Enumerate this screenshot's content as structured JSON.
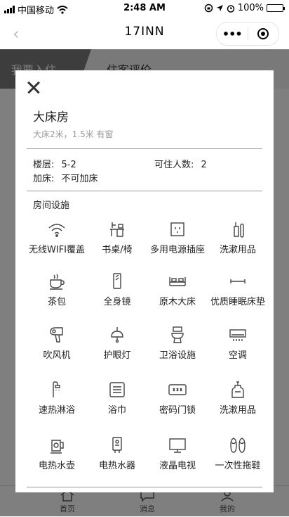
{
  "status": {
    "carrier": "中国移动",
    "time": "2:48 AM",
    "battery": "100%"
  },
  "nav": {
    "title": "17INN"
  },
  "page": {
    "tabs": [
      "我要入住",
      "住客评价"
    ],
    "bottom": [
      "首页",
      "消息",
      "我的"
    ]
  },
  "modal": {
    "room_name": "大床房",
    "room_desc": "大床2米，1.5米 有窗",
    "floor_label": "楼层:",
    "floor_value": "5-2",
    "capacity_label": "可住人数:",
    "capacity_value": "2",
    "extra_bed_label": "加床:",
    "extra_bed_value": "不可加床",
    "section_title": "房间设施",
    "facilities": [
      {
        "label": "无线WIFI覆盖",
        "icon": "wifi-icon"
      },
      {
        "label": "书桌/椅",
        "icon": "desk-icon"
      },
      {
        "label": "多用电源插座",
        "icon": "socket-icon"
      },
      {
        "label": "洗漱用品",
        "icon": "toiletries-icon"
      },
      {
        "label": "茶包",
        "icon": "teacup-icon"
      },
      {
        "label": "全身镜",
        "icon": "mirror-icon"
      },
      {
        "label": "原木大床",
        "icon": "bed-icon"
      },
      {
        "label": "优质睡眠床垫",
        "icon": "mattress-icon"
      },
      {
        "label": "吹风机",
        "icon": "hairdryer-icon"
      },
      {
        "label": "护眼灯",
        "icon": "lamp-icon"
      },
      {
        "label": "卫浴设施",
        "icon": "toilet-icon"
      },
      {
        "label": "空调",
        "icon": "aircon-icon"
      },
      {
        "label": "速热淋浴",
        "icon": "shower-icon"
      },
      {
        "label": "浴巾",
        "icon": "towel-icon"
      },
      {
        "label": "密码门锁",
        "icon": "lock-icon"
      },
      {
        "label": "洗漱用品",
        "icon": "soap-icon"
      },
      {
        "label": "电热水壶",
        "icon": "kettle-icon"
      },
      {
        "label": "电热水器",
        "icon": "water-heater-icon"
      },
      {
        "label": "液晶电视",
        "icon": "tv-icon"
      },
      {
        "label": "一次性拖鞋",
        "icon": "slippers-icon"
      }
    ]
  }
}
